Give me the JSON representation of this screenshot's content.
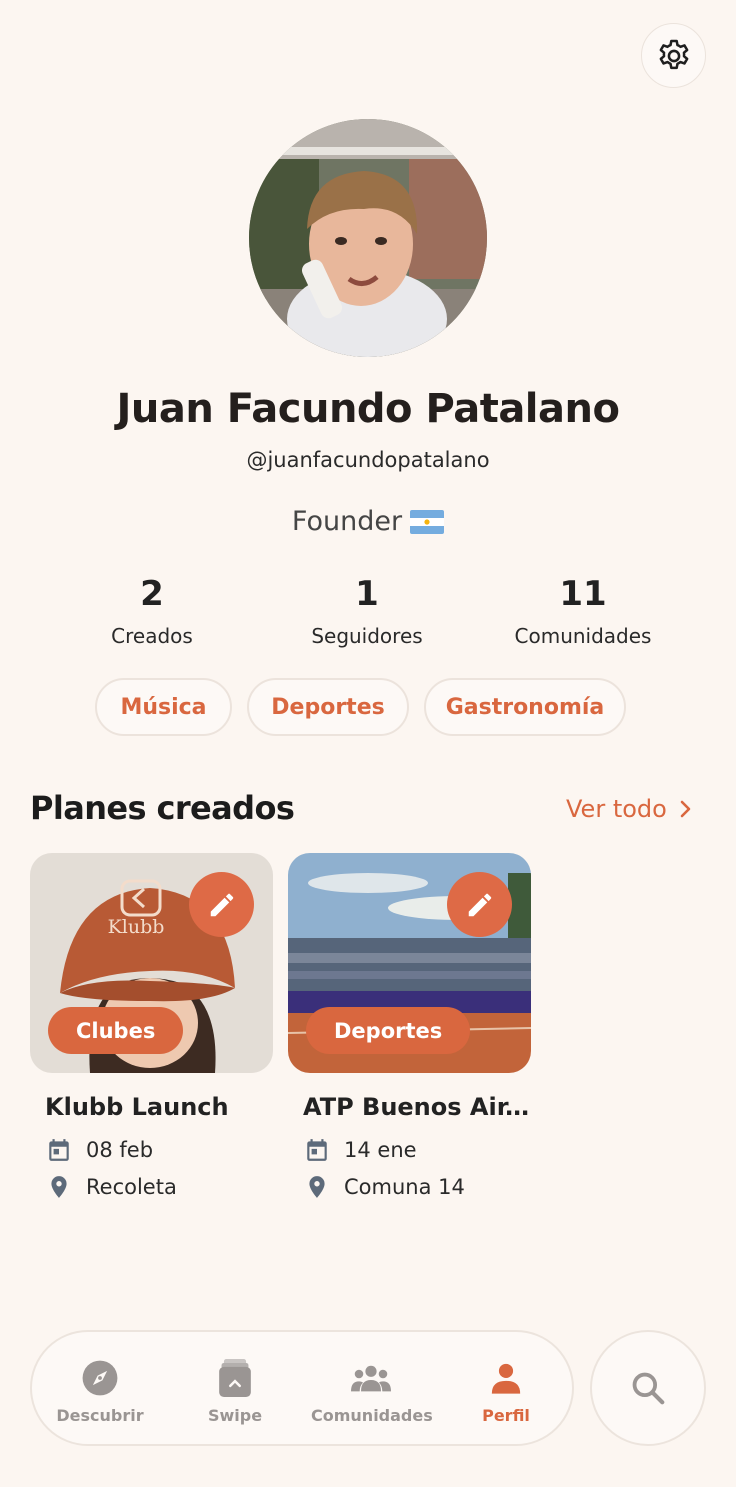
{
  "profile": {
    "name": "Juan Facundo Patalano",
    "handle": "@juanfacundopatalano",
    "bio": "Founder",
    "bio_flag": "argentina-flag-icon"
  },
  "stats": [
    {
      "value": "2",
      "label": "Creados"
    },
    {
      "value": "1",
      "label": "Seguidores"
    },
    {
      "value": "11",
      "label": "Comunidades"
    }
  ],
  "interests": [
    "Música",
    "Deportes",
    "Gastronomía"
  ],
  "section": {
    "title": "Planes creados",
    "see_all": "Ver todo"
  },
  "plans": [
    {
      "title": "Klubb Launch",
      "category": "Clubes",
      "date": "08 feb",
      "location": "Recoleta",
      "cap_logo": "Klubb"
    },
    {
      "title": "ATP Buenos Air...",
      "category": "Deportes",
      "date": "14 ene",
      "location": "Comuna 14"
    }
  ],
  "tabs": [
    {
      "label": "Descubrir",
      "icon": "compass-icon"
    },
    {
      "label": "Swipe",
      "icon": "card-stack-icon"
    },
    {
      "label": "Comunidades",
      "icon": "people-icon"
    },
    {
      "label": "Perfil",
      "icon": "person-icon",
      "active": true
    }
  ],
  "colors": {
    "accent": "#d9673f",
    "background": "#fcf6f1",
    "inactive": "#9a9593"
  }
}
